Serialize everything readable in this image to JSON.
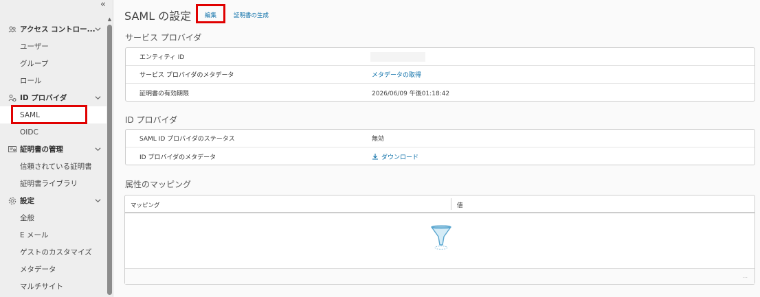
{
  "sidebar": {
    "collapse_glyph": "«",
    "groups": [
      {
        "label": "アクセス コントロー...",
        "icon": "users-icon",
        "items": [
          {
            "label": "ユーザー"
          },
          {
            "label": "グループ"
          },
          {
            "label": "ロール"
          }
        ]
      },
      {
        "label": "ID プロバイダ",
        "icon": "identity-provider-icon",
        "items": [
          {
            "label": "SAML",
            "active": true
          },
          {
            "label": "OIDC"
          }
        ]
      },
      {
        "label": "証明書の管理",
        "icon": "certificate-icon",
        "items": [
          {
            "label": "信頼されている証明書"
          },
          {
            "label": "証明書ライブラリ"
          }
        ]
      },
      {
        "label": "設定",
        "icon": "gear-icon",
        "items": [
          {
            "label": "全般"
          },
          {
            "label": "E メール"
          },
          {
            "label": "ゲストのカスタマイズ"
          },
          {
            "label": "メタデータ"
          },
          {
            "label": "マルチサイト"
          }
        ]
      }
    ]
  },
  "header": {
    "title": "SAML の設定",
    "edit_label": "編集",
    "generate_cert_label": "証明書の生成"
  },
  "service_provider": {
    "title": "サービス プロバイダ",
    "rows": {
      "entity_id_label": "エンティティ ID",
      "metadata_label": "サービス プロバイダのメタデータ",
      "metadata_link": "メタデータの取得",
      "cert_expiry_label": "証明書の有効期限",
      "cert_expiry_value": "2026/06/09 午後01:18:42"
    }
  },
  "identity_provider": {
    "title": "ID プロバイダ",
    "rows": {
      "status_label": "SAML ID プロバイダのステータス",
      "status_value": "無効",
      "metadata_label": "ID プロバイダのメタデータ",
      "download_link": "ダウンロード"
    }
  },
  "attribute_mapping": {
    "title": "属性のマッピング",
    "columns": [
      "マッピング",
      "値"
    ],
    "rows": [],
    "footer_text": "..."
  },
  "colors": {
    "accent": "#0b6fa8",
    "highlight": "#e00000",
    "sidebar_bg": "#eeeeee"
  }
}
